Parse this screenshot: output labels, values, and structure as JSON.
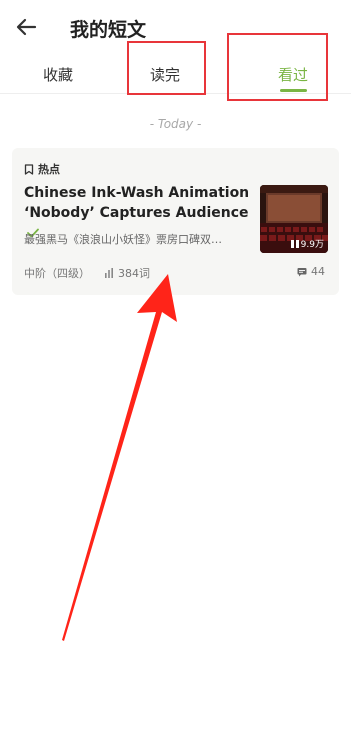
{
  "header": {
    "title": "我的短文",
    "back_icon": "arrow-left-icon"
  },
  "tabs": [
    {
      "label": "收藏",
      "active": false
    },
    {
      "label": "读完",
      "active": false
    },
    {
      "label": "看过",
      "active": true
    }
  ],
  "accent_color": "#7ab544",
  "highlight_color": "#e8353a",
  "date_separator": "- Today -",
  "card": {
    "tag": "热点",
    "title": "Chinese Ink-Wash Animation ‘Nobody’ Captures Audience",
    "summary": "最强黑马《浪浪山小妖怪》票房口碑双…",
    "thumb_views": "9.9万",
    "level": "中阶（四级）",
    "words": "384词",
    "comments": "44"
  }
}
